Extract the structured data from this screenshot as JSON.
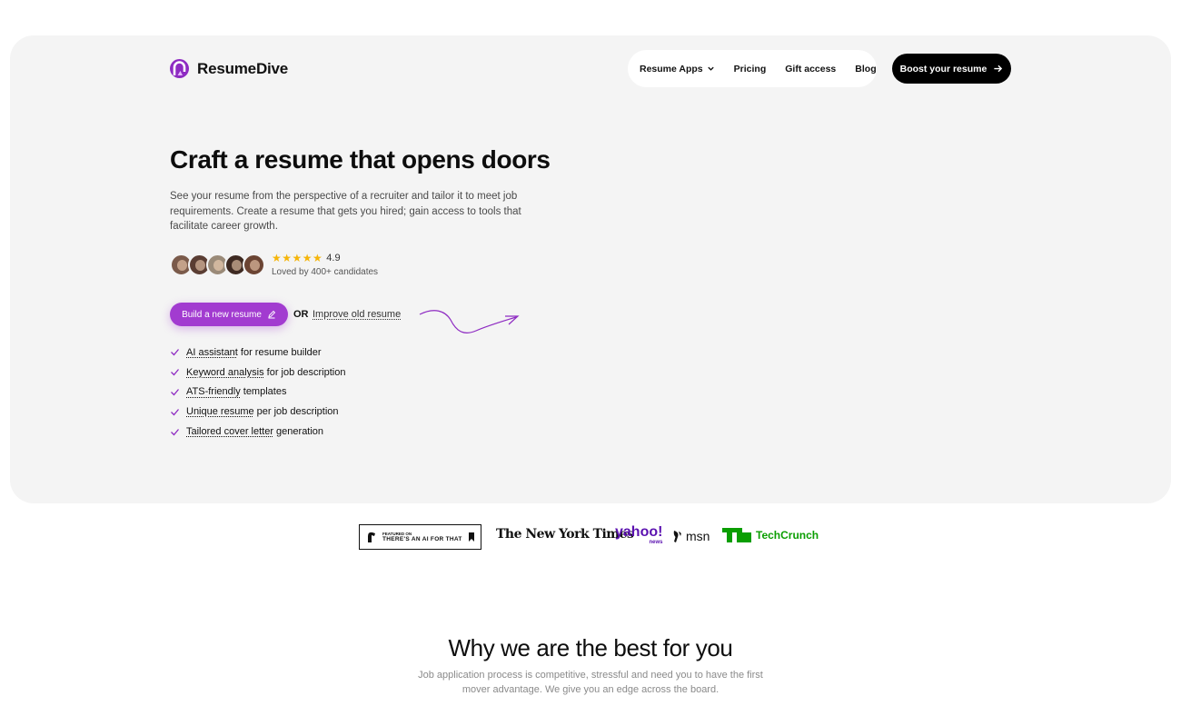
{
  "brand": {
    "name": "ResumeDive",
    "accent": "#a23bd0"
  },
  "nav": {
    "items": [
      {
        "label": "Resume Apps",
        "icon": "chevron-down-icon"
      },
      {
        "label": "Pricing"
      },
      {
        "label": "Gift access"
      },
      {
        "label": "Blog"
      }
    ],
    "cta_label": "Boost your resume"
  },
  "hero": {
    "title": "Craft a resume that opens doors",
    "description": "See your resume from the perspective of a recruiter and tailor it to meet job requirements. Create a resume that gets you hired; gain access to tools that facilitate career growth.",
    "rating": {
      "stars": 5,
      "score": "4.9",
      "caption": "Loved by 400+ candidates"
    },
    "primary_cta": "Build a new resume",
    "or_text": "OR",
    "secondary_cta": "Improve old resume",
    "features": [
      {
        "highlight": "AI assistant",
        "rest": " for resume builder"
      },
      {
        "highlight": "Keyword analysis",
        "rest": " for job description"
      },
      {
        "highlight": "ATS-friendly",
        "rest": " templates"
      },
      {
        "highlight": "Unique resume",
        "rest": " per job description"
      },
      {
        "highlight": "Tailored cover letter",
        "rest": " generation"
      }
    ]
  },
  "press": {
    "aift_small": "FEATURED ON",
    "aift_main": "THERE'S AN AI FOR THAT",
    "nyt": "The New York Times",
    "yahoo": "yahoo!",
    "yahoo_sub": "news",
    "msn": "msn",
    "techcrunch": "TechCrunch"
  },
  "why": {
    "title": "Why we are the best for you",
    "subtitle": "Job application process is competitive, stressful and need you to have the first mover advantage. We give you an edge across the board."
  }
}
